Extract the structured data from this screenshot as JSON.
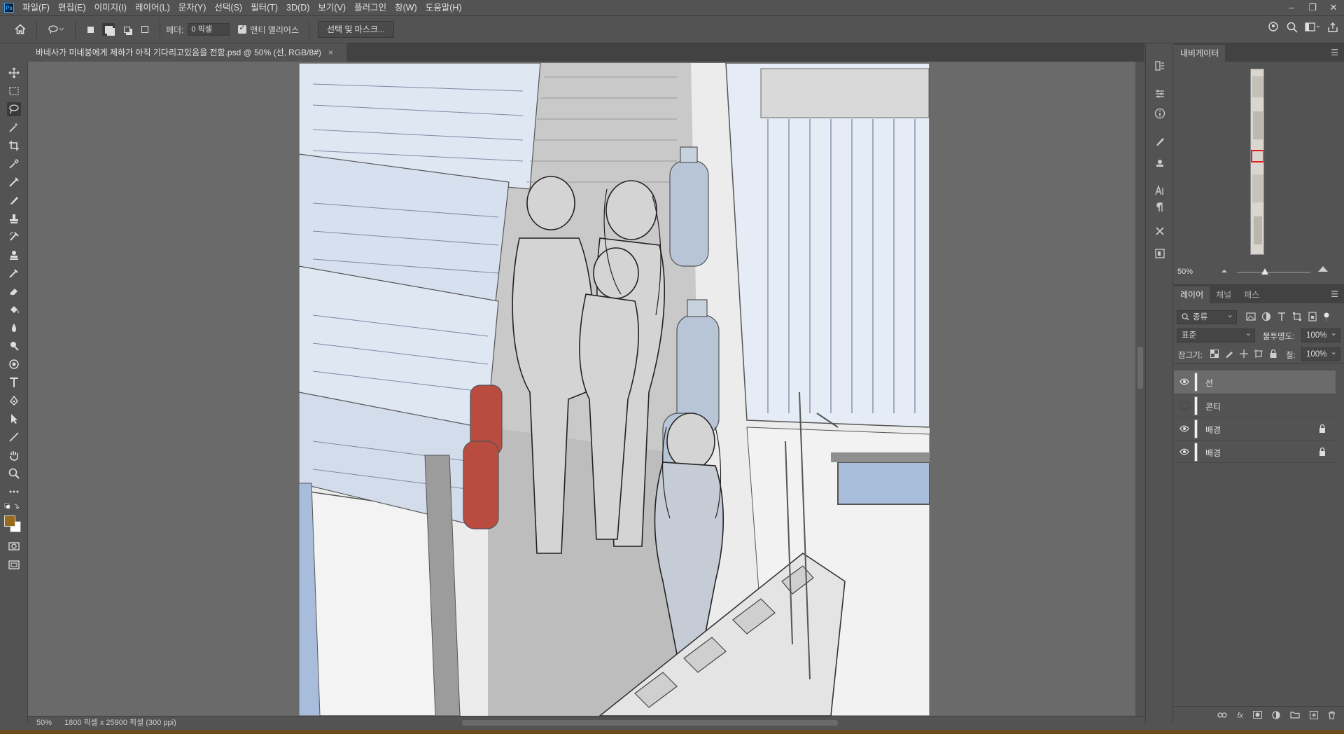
{
  "app": {
    "menu": [
      "파일(F)",
      "편집(E)",
      "이미지(I)",
      "레이어(L)",
      "문자(Y)",
      "선택(S)",
      "필터(T)",
      "3D(D)",
      "보기(V)",
      "플러그인",
      "창(W)",
      "도움말(H)"
    ],
    "window_controls": [
      "–",
      "❐",
      "✕"
    ]
  },
  "options": {
    "feather_label": "페더:",
    "feather_value": "0 픽셀",
    "antialias_label": "앤티 앨리어스",
    "select_mask_label": "선택 및 마스크..."
  },
  "document": {
    "tab_title": "바네사가 미네붕에게 제하가 아직 기다리고있음을 전함.psd @ 50% (선, RGB/8#)",
    "close": "×"
  },
  "status": {
    "zoom": "50%",
    "dims": "1800 픽셀 x 25900 픽셀 (300 ppi)"
  },
  "navigator": {
    "tab": "내비게이터",
    "zoom": "50%"
  },
  "layers_panel": {
    "tabs": [
      "레이어",
      "채널",
      "패스"
    ],
    "filter_label": "종류",
    "blend_mode": "표준",
    "opacity_label": "불투명도:",
    "opacity_value": "100%",
    "lock_label": "잠그기:",
    "fill_label": "칠:",
    "fill_value": "100%",
    "layers": [
      {
        "name": "선",
        "visible": true,
        "locked": false,
        "selected": true
      },
      {
        "name": "콘티",
        "visible": false,
        "locked": false,
        "selected": false
      },
      {
        "name": "배경",
        "visible": true,
        "locked": true,
        "selected": false
      },
      {
        "name": "배경",
        "visible": true,
        "locked": true,
        "selected": false
      }
    ]
  },
  "colors": {
    "foreground": "#9a6a1c",
    "background": "#ffffff"
  }
}
